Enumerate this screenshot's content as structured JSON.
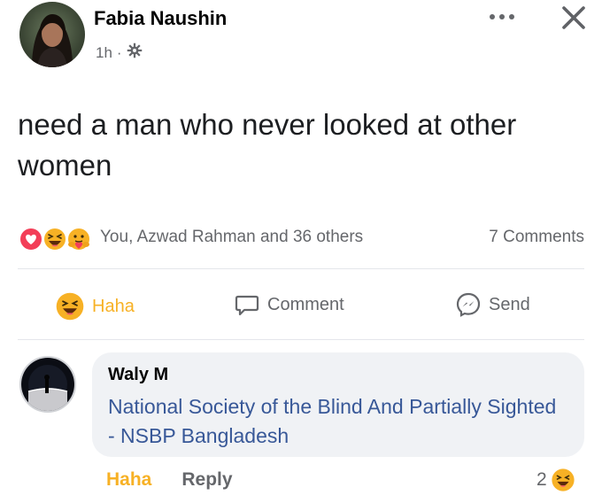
{
  "post": {
    "author": "Fabia Naushin",
    "time": "1h",
    "separator": "·",
    "privacy_icon": "settings-gear-icon",
    "text": "need a man who never looked at other women",
    "reactions": {
      "icons": [
        "love-icon",
        "haha-icon",
        "care-icon"
      ],
      "summary": "You, Azwad Rahman and 36 others"
    },
    "comments_count": "7 Comments"
  },
  "actions": {
    "haha": "Haha",
    "comment": "Comment",
    "send": "Send"
  },
  "comment": {
    "author": "Waly M",
    "text": "National Society of the Blind And Partially Sighted - NSBP Bangladesh",
    "haha_label": "Haha",
    "reply_label": "Reply",
    "reaction_count": "2",
    "reaction_icon": "haha-icon"
  },
  "colors": {
    "haha": "#f7b125",
    "link_text": "#385898",
    "muted": "#65676b",
    "love": "#f33e58",
    "bubble": "#f0f2f5"
  }
}
